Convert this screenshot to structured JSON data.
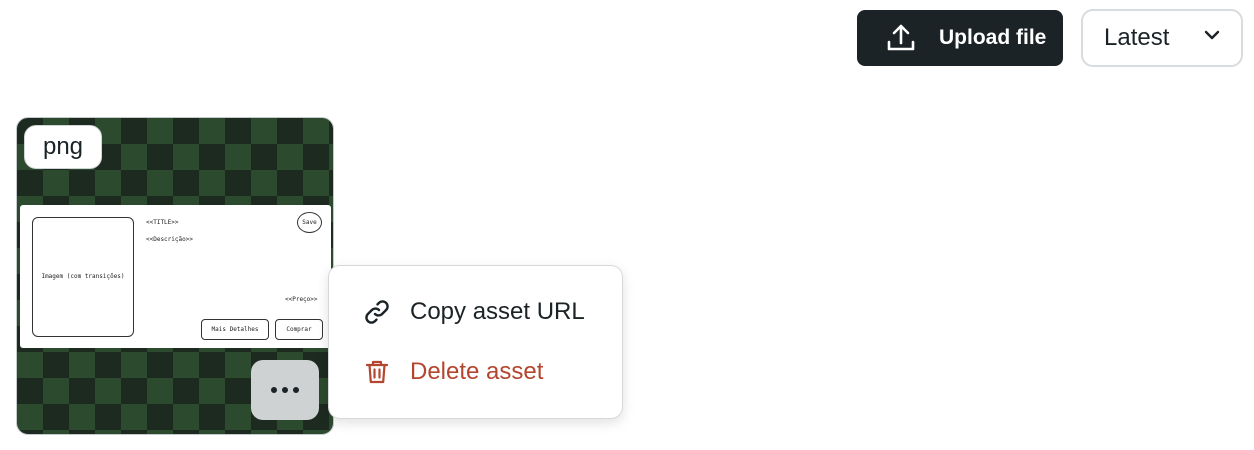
{
  "toolbar": {
    "upload_label": "Upload file",
    "upload_icon": "upload-icon",
    "sort_value": "Latest",
    "sort_icon": "chevron-down-icon"
  },
  "asset": {
    "type_badge": "png",
    "preview": {
      "image_placeholder": "Imagem (com transições)",
      "title": "<<TITLE>>",
      "description": "<<Descrição>>",
      "price": "<<Preço>>",
      "save": "Save",
      "more_details": "Mais Detalhes",
      "buy": "Comprar"
    },
    "more_icon": "more-horizontal-icon"
  },
  "context_menu": {
    "items": [
      {
        "label": "Copy asset URL",
        "icon": "link-icon"
      },
      {
        "label": "Delete asset",
        "icon": "trash-icon",
        "color": "#b4452f"
      }
    ]
  },
  "colors": {
    "primary_button_bg": "#1b2326",
    "danger": "#b4452f",
    "checker_light": "#2c4a2e",
    "checker_dark": "#1d2a1f"
  }
}
